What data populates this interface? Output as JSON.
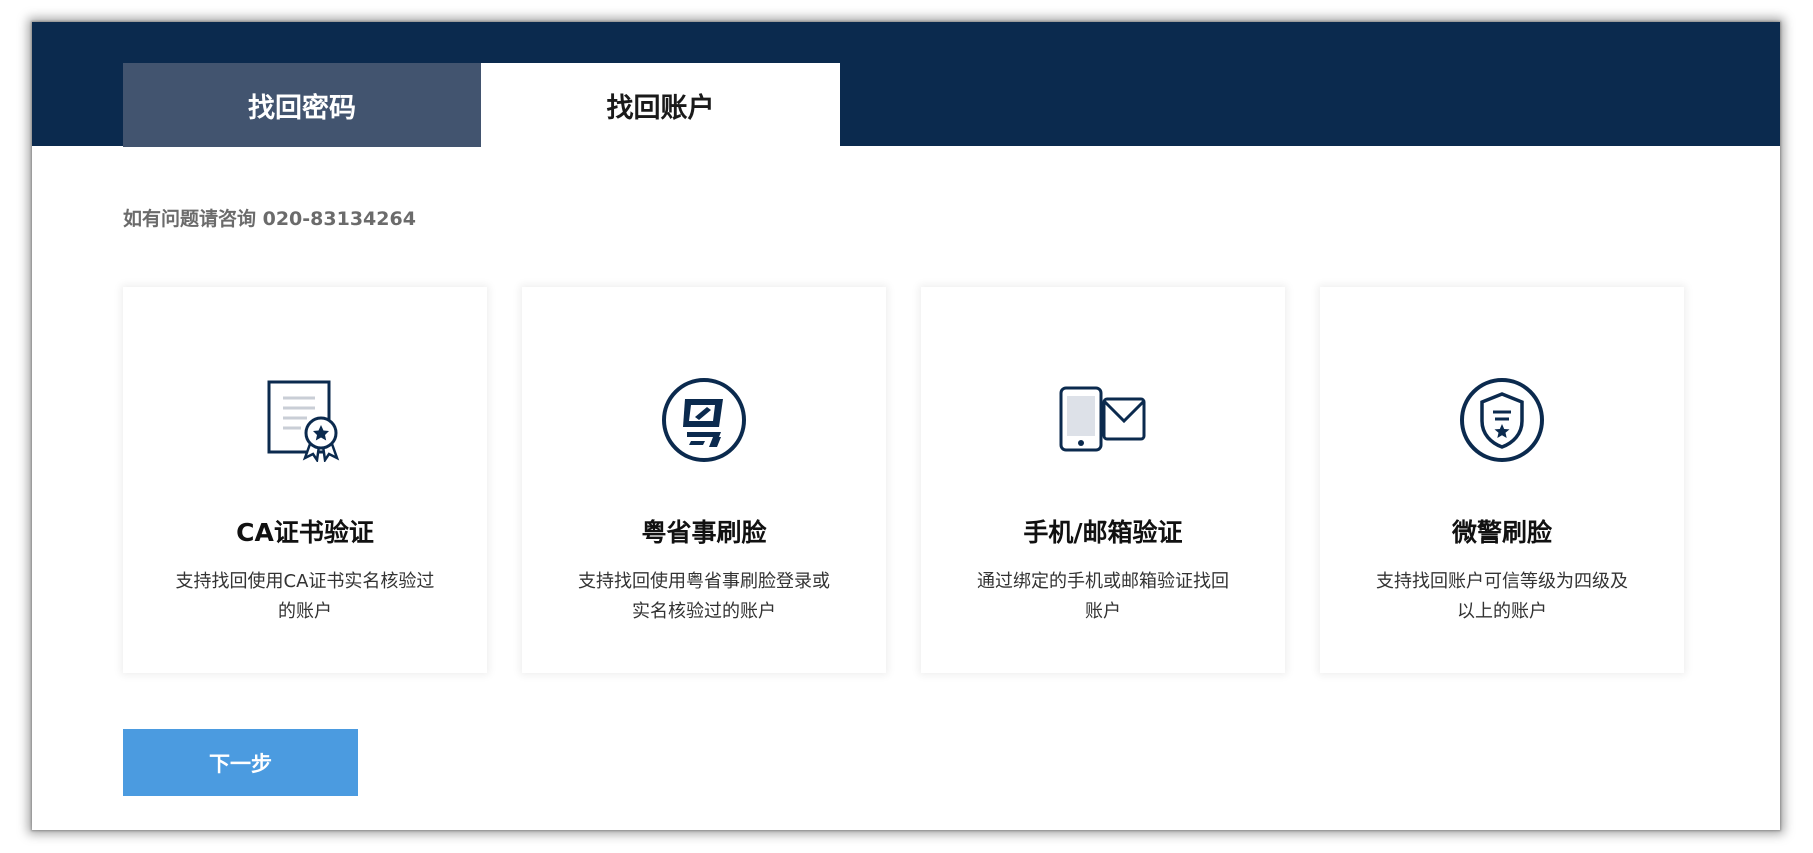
{
  "tabs": {
    "password_label": "找回密码",
    "account_label": "找回账户"
  },
  "hint": "如有问题请咨询 020-83134264",
  "cards": [
    {
      "title": "CA证书验证",
      "desc_line1": "支持找回使用CA证书实名核验过",
      "desc_line2": "的账户",
      "icon": "certificate-icon"
    },
    {
      "title": "粤省事刷脸",
      "desc_line1": "支持找回使用粤省事刷脸登录或",
      "desc_line2": "实名核验过的账户",
      "icon": "yue-sheng-shi-icon"
    },
    {
      "title": "手机/邮箱验证",
      "desc_line1": "通过绑定的手机或邮箱验证找回",
      "desc_line2": "账户",
      "icon": "phone-mail-icon"
    },
    {
      "title": "微警刷脸",
      "desc_line1": "支持找回账户可信等级为四级及",
      "desc_line2": "以上的账户",
      "icon": "police-shield-icon"
    }
  ],
  "next_button_label": "下一步",
  "colors": {
    "header": "#0b2a4e",
    "inactive_tab": "#42546f",
    "button": "#4b9be0",
    "icon": "#0b2a4e"
  }
}
